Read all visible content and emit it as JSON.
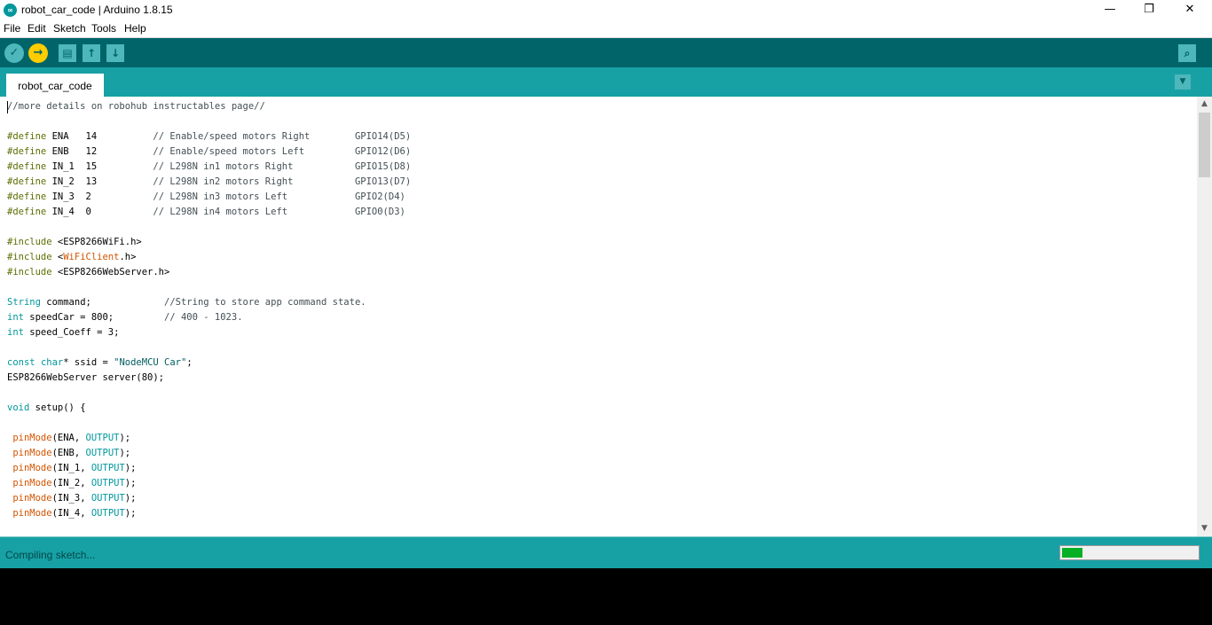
{
  "window": {
    "title": "robot_car_code | Arduino 1.8.15",
    "app_icon": "arduino-logo-icon",
    "controls": {
      "minimize": "—",
      "maximize": "❐",
      "close": "✕"
    }
  },
  "menu": [
    "File",
    "Edit",
    "Sketch",
    "Tools",
    "Help"
  ],
  "toolbar": {
    "verify": "✓",
    "upload": "→",
    "new": "▤",
    "open": "↑",
    "save": "↓",
    "serial_monitor": "⌕"
  },
  "tabs": {
    "active": "robot_car_code",
    "menu_glyph": "▼"
  },
  "editor": {
    "lines": [
      "//more details on robohub instructables page//",
      "",
      "#define ENA   14          // Enable/speed motors Right        GPIO14(D5)",
      "#define ENB   12          // Enable/speed motors Left         GPIO12(D6)",
      "#define IN_1  15          // L298N in1 motors Right           GPIO15(D8)",
      "#define IN_2  13          // L298N in2 motors Right           GPIO13(D7)",
      "#define IN_3  2           // L298N in3 motors Left            GPIO2(D4)",
      "#define IN_4  0           // L298N in4 motors Left            GPIO0(D3)",
      "",
      "#include <ESP8266WiFi.h>",
      "#include <WiFiClient.h>",
      "#include <ESP8266WebServer.h>",
      "",
      "String command;             //String to store app command state.",
      "int speedCar = 800;         // 400 - 1023.",
      "int speed_Coeff = 3;",
      "",
      "const char* ssid = \"NodeMCU Car\";",
      "ESP8266WebServer server(80);",
      "",
      "void setup() {",
      "",
      " pinMode(ENA, OUTPUT);",
      " pinMode(ENB, OUTPUT);",
      " pinMode(IN_1, OUTPUT);",
      " pinMode(IN_2, OUTPUT);",
      " pinMode(IN_3, OUTPUT);",
      " pinMode(IN_4, OUTPUT);"
    ]
  },
  "status": {
    "text": "Compiling sketch...",
    "progress_percent": 15
  },
  "colors": {
    "toolbar": "#006468",
    "accent": "#17a1a5",
    "upload_button": "#ffcc00",
    "progress": "#06b025"
  }
}
